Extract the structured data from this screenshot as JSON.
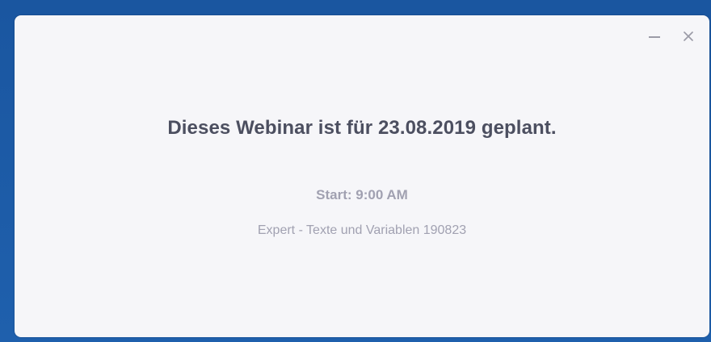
{
  "dialog": {
    "headline": "Dieses Webinar ist für 23.08.2019 geplant.",
    "start_text": "Start: 9:00 AM",
    "topic": "Expert - Texte und Variablen 190823"
  },
  "window_controls": {
    "minimize_icon": "minimize-icon",
    "close_icon": "close-icon"
  },
  "colors": {
    "backdrop": "#1c5aa6",
    "dialog_background": "#f6f6f9",
    "headline_text": "#4c4f60",
    "secondary_text": "#a1a1b1",
    "controls": "#9b9ba7"
  }
}
